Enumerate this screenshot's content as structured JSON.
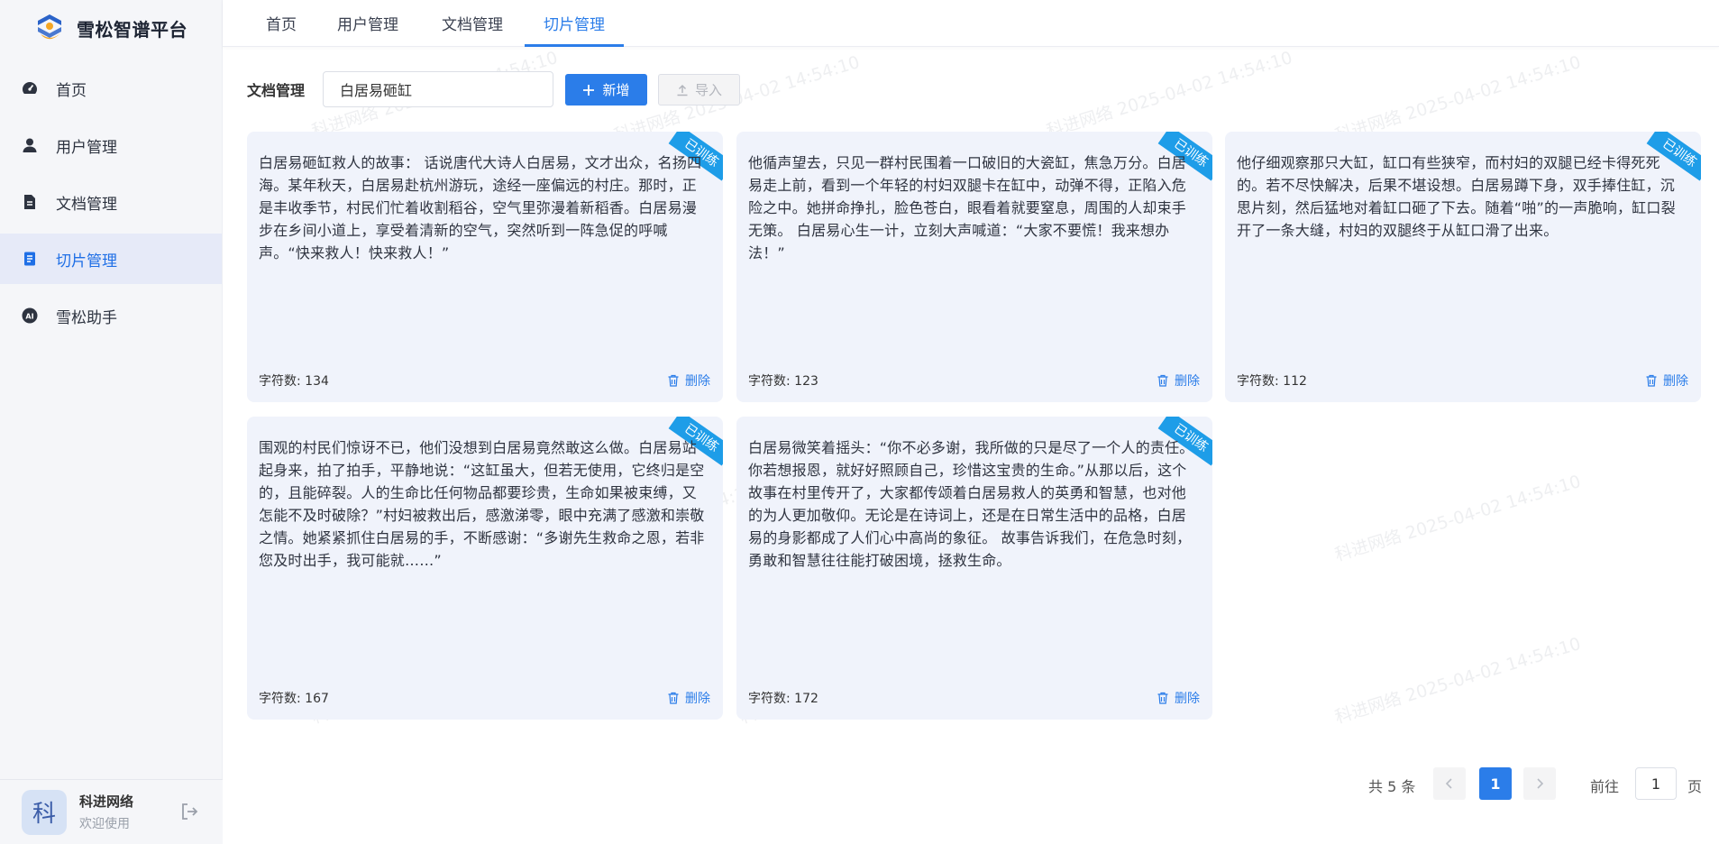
{
  "app": {
    "title": "雪松智谱平台"
  },
  "sidebar": {
    "items": [
      {
        "label": "首页",
        "icon": "dashboard-icon",
        "active": false
      },
      {
        "label": "用户管理",
        "icon": "user-icon",
        "active": false
      },
      {
        "label": "文档管理",
        "icon": "document-icon",
        "active": false
      },
      {
        "label": "切片管理",
        "icon": "slice-icon",
        "active": true
      },
      {
        "label": "雪松助手",
        "icon": "ai-icon",
        "active": false
      }
    ],
    "ai_badge": "AI"
  },
  "user": {
    "avatar_char": "科",
    "name": "科进网络",
    "subtitle": "欢迎使用"
  },
  "tabs": [
    {
      "label": "首页",
      "active": false
    },
    {
      "label": "用户管理",
      "active": false
    },
    {
      "label": "文档管理",
      "active": false
    },
    {
      "label": "切片管理",
      "active": true
    }
  ],
  "toolbar": {
    "label": "文档管理",
    "search_value": "白居易砸缸",
    "add_label": "新增",
    "import_label": "导入"
  },
  "cards": [
    {
      "text": "白居易砸缸救人的故事： 话说唐代大诗人白居易，文才出众，名扬四海。某年秋天，白居易赴杭州游玩，途经一座偏远的村庄。那时，正是丰收季节，村民们忙着收割稻谷，空气里弥漫着新稻香。白居易漫步在乡间小道上，享受着清新的空气，突然听到一阵急促的呼喊声。“快来救人！快来救人！”",
      "count": "字符数: 134",
      "badge": "已训练",
      "delete_label": "删除"
    },
    {
      "text": "他循声望去，只见一群村民围着一口破旧的大瓷缸，焦急万分。白居易走上前，看到一个年轻的村妇双腿卡在缸中，动弹不得，正陷入危险之中。她拼命挣扎，脸色苍白，眼看着就要窒息，周围的人却束手无策。 白居易心生一计，立刻大声喊道：“大家不要慌！我来想办法！”",
      "count": "字符数: 123",
      "badge": "已训练",
      "delete_label": "删除"
    },
    {
      "text": "他仔细观察那只大缸，缸口有些狭窄，而村妇的双腿已经卡得死死的。若不尽快解决，后果不堪设想。白居易蹲下身，双手捧住缸，沉思片刻，然后猛地对着缸口砸了下去。随着“啪”的一声脆响，缸口裂开了一条大缝，村妇的双腿终于从缸口滑了出来。",
      "count": "字符数: 112",
      "badge": "已训练",
      "delete_label": "删除"
    },
    {
      "text": "围观的村民们惊讶不已，他们没想到白居易竟然敢这么做。白居易站起身来，拍了拍手，平静地说：“这缸虽大，但若无使用，它终归是空的，且能碎裂。人的生命比任何物品都要珍贵，生命如果被束缚，又怎能不及时破除？”村妇被救出后，感激涕零，眼中充满了感激和崇敬之情。她紧紧抓住白居易的手，不断感谢：“多谢先生救命之恩，若非您及时出手，我可能就……”",
      "count": "字符数: 167",
      "badge": "已训练",
      "delete_label": "删除"
    },
    {
      "text": "白居易微笑着摇头：“你不必多谢，我所做的只是尽了一个人的责任。你若想报恩，就好好照顾自己，珍惜这宝贵的生命。”从那以后，这个故事在村里传开了，大家都传颂着白居易救人的英勇和智慧，也对他的为人更加敬仰。无论是在诗词上，还是在日常生活中的品格，白居易的身影都成了人们心中高尚的象征。 故事告诉我们，在危急时刻，勇敢和智慧往往能打破困境，拯救生命。",
      "count": "字符数: 172",
      "badge": "已训练",
      "delete_label": "删除"
    }
  ],
  "pagination": {
    "total": "共 5 条",
    "current": "1",
    "goto_label": "前往",
    "goto_value": "1",
    "page_suffix": "页"
  },
  "watermark": "科进网络 2025-04-02 14:54:10",
  "colors": {
    "accent": "#2b7de9",
    "badge": "#1e9de8",
    "card_bg": "#f0f3fb"
  }
}
